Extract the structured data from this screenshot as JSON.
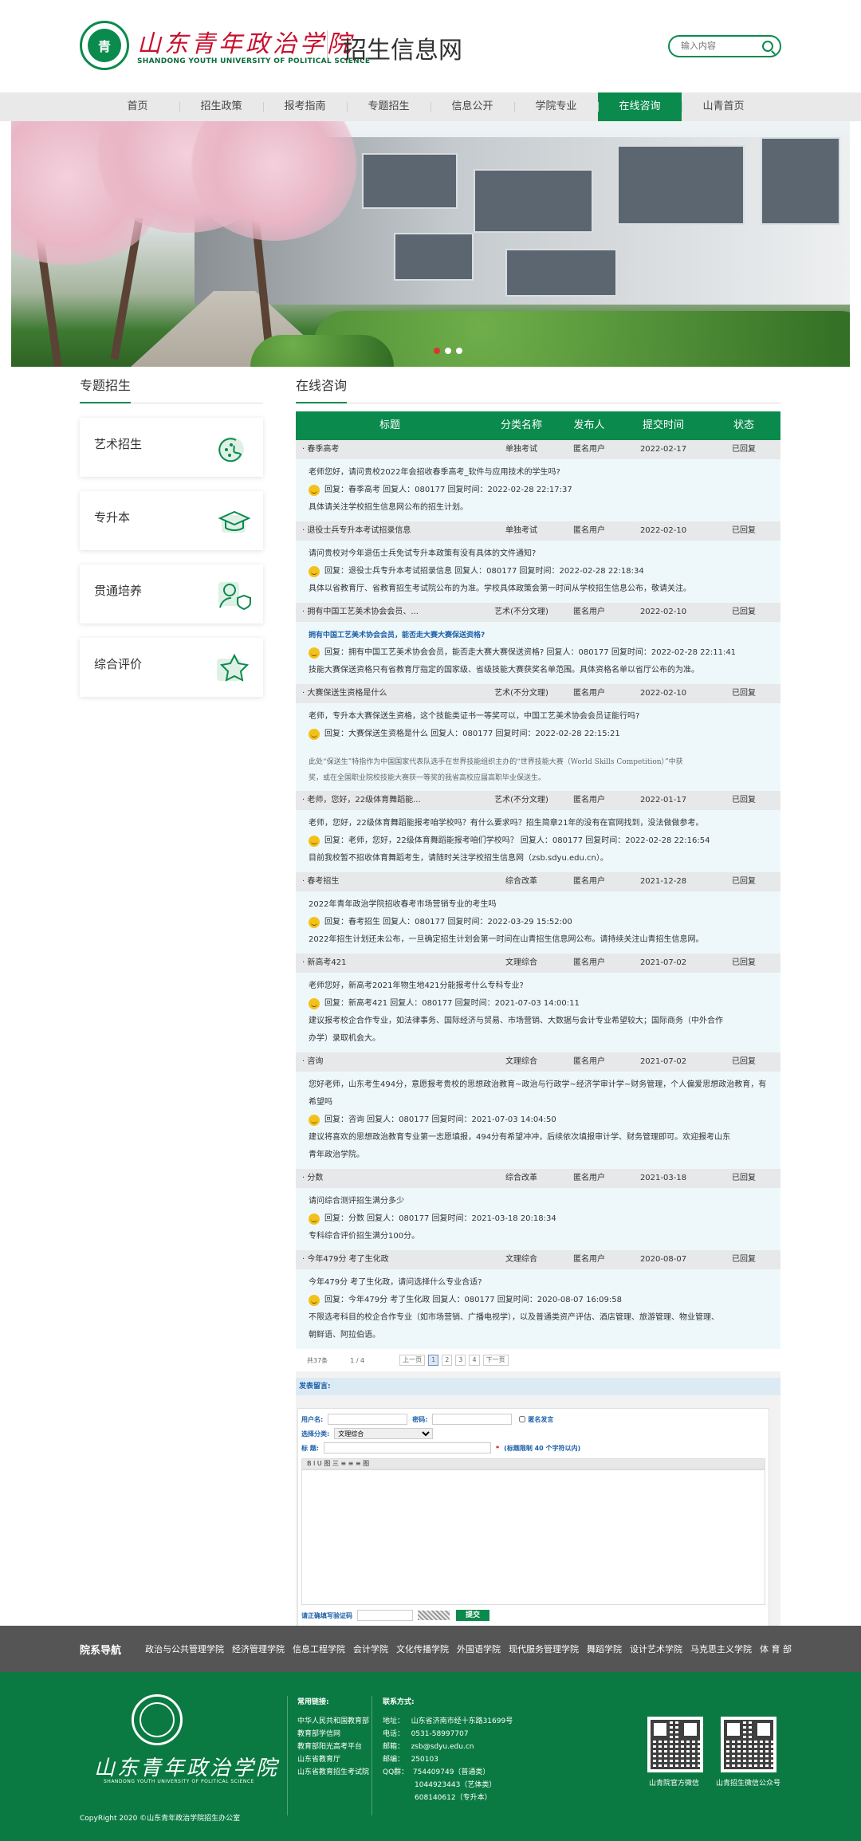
{
  "header": {
    "logo_cn": "山东青年政治学院",
    "logo_en": "SHANDONG YOUTH UNIVERSITY OF POLITICAL SCIENCE",
    "site_title": "招生信息网",
    "search_placeholder": "输入内容"
  },
  "nav": [
    "首页",
    "招生政策",
    "报考指南",
    "专题招生",
    "信息公开",
    "学院专业",
    "在线咨询",
    "山青首页"
  ],
  "nav_active": "在线咨询",
  "sidebar": {
    "title": "专题招生",
    "items": [
      "艺术招生",
      "专升本",
      "贯通培养",
      "综合评价"
    ]
  },
  "main": {
    "title": "在线咨询",
    "columns": [
      "标题",
      "分类名称",
      "发布人",
      "提交时间",
      "状态"
    ],
    "rows": [
      {
        "title": "· 春季高考",
        "cat": "单独考试",
        "user": "匿名用户",
        "date": "2022-02-17",
        "status": "已回复",
        "q": "老师您好，请问贵校2022年会招收春季高考_软件与应用技术的学生吗?",
        "r": "回复：春季高考 回复人：080177 回复时间：2022-02-28 22:17:37",
        "a": [
          "具体请关注学校招生信息网公布的招生计划。"
        ]
      },
      {
        "title": "· 退役士兵专升本考试招录信息",
        "cat": "单独考试",
        "user": "匿名用户",
        "date": "2022-02-10",
        "status": "已回复",
        "q": "请问贵校对今年退伍士兵免试专升本政策有没有具体的文件通知?",
        "r": "回复：退役士兵专升本考试招录信息 回复人：080177 回复时间：2022-02-28 22:18:34",
        "a": [
          "具体以省教育厅、省教育招生考试院公布的为准。学校具体政策会第一时间从学校招生信息公布，敬请关注。"
        ]
      },
      {
        "title": "· 拥有中国工艺美术协会会员、...",
        "cat": "艺术(不分文理)",
        "user": "匿名用户",
        "date": "2022-02-10",
        "status": "已回复",
        "q": "拥有中国工艺美术协会会员，能否走大赛大赛保送资格?",
        "r": "回复：拥有中国工艺美术协会会员，能否走大赛大赛保送资格?  回复人：080177 回复时间：2022-02-28 22:11:41",
        "a": [
          "技能大赛保送资格只有省教育厅指定的国家级、省级技能大赛获奖名单范围。具体资格名单以省厅公布的为准。"
        ]
      },
      {
        "title": "· 大赛保送生资格是什么",
        "cat": "艺术(不分文理)",
        "user": "匿名用户",
        "date": "2022-02-10",
        "status": "已回复",
        "q": "老师，专升本大赛保送生资格，这个技能类证书一等奖可以，中国工艺美术协会会员证能行吗?",
        "r": "回复：大赛保送生资格是什么 回复人：080177 回复时间：2022-02-28 22:15:21",
        "a": [
          "此处“保送生”特指作为中国国家代表队选手在世界技能组织主办的“世界技能大赛（World Skills Competition）”中获",
          "奖，或在全国职业院校技能大赛获一等奖的我省高校应届高职毕业保送生。"
        ]
      },
      {
        "title": "· 老师，您好，22级体育舞蹈能...",
        "cat": "艺术(不分文理)",
        "user": "匿名用户",
        "date": "2022-01-17",
        "status": "已回复",
        "q": "老师，您好，22级体育舞蹈能报考咱学校吗？有什么要求吗？招生简章21年的没有在官网找到，没法做做参考。",
        "r": "回复：老师，您好，22级体育舞蹈能报考咱们学校吗？  回复人：080177 回复时间：2022-02-28 22:16:54",
        "a": [
          "目前我校暂不招收体育舞蹈考生，请随时关注学校招生信息网（zsb.sdyu.edu.cn）。"
        ]
      },
      {
        "title": "· 春考招生",
        "cat": "综合改革",
        "user": "匿名用户",
        "date": "2021-12-28",
        "status": "已回复",
        "q": "2022年青年政治学院招收春考市场营销专业的考生吗",
        "r": "回复：春考招生 回复人：080177 回复时间：2022-03-29 15:52:00",
        "a": [
          "2022年招生计划还未公布，一旦确定招生计划会第一时间在山青招生信息网公布。请持续关注山青招生信息网。"
        ]
      },
      {
        "title": "· 新高考421",
        "cat": "文理综合",
        "user": "匿名用户",
        "date": "2021-07-02",
        "status": "已回复",
        "q": "老师您好，新高考2021年物生地421分能报考什么专科专业?",
        "r": "回复：新高考421 回复人：080177 回复时间：2021-07-03 14:00:11",
        "a": [
          "建议报考校企合作专业，如法律事务、国际经济与贸易、市场营销、大数据与会计专业希望较大；国际商务（中外合作",
          "办学）录取机会大。"
        ]
      },
      {
        "title": "· 咨询",
        "cat": "文理综合",
        "user": "匿名用户",
        "date": "2021-07-02",
        "status": "已回复",
        "q": "您好老师，山东考生494分，意愿报考贵校的思想政治教育~政治与行政学~经济学审计学~财务管理，个人偏爱思想政治教育，有希望吗",
        "r": "回复：咨询 回复人：080177 回复时间：2021-07-03 14:04:50",
        "a": [
          "建议将喜欢的思想政治教育专业第一志愿填报，494分有希望冲冲，后续依次填报审计学、财务管理即可。欢迎报考山东",
          "青年政治学院。"
        ]
      },
      {
        "title": "· 分数",
        "cat": "综合改革",
        "user": "匿名用户",
        "date": "2021-03-18",
        "status": "已回复",
        "q": "请问综合测评招生满分多少",
        "r": "回复：分数 回复人：080177 回复时间：2021-03-18 20:18:34",
        "a": [
          "专科综合评价招生满分100分。"
        ]
      },
      {
        "title": "· 今年479分 考了生化政",
        "cat": "文理综合",
        "user": "匿名用户",
        "date": "2020-08-07",
        "status": "已回复",
        "q": "今年479分 考了生化政，请问选择什么专业合适?",
        "r": "回复：今年479分 考了生化政 回复人：080177 回复时间：2020-08-07 16:09:58",
        "a": [
          "不限选考科目的校企合作专业（如市场营销、广播电视学），以及普通类资产评估、酒店管理、旅游管理、物业管理、",
          "朝鲜语、阿拉伯语。"
        ]
      }
    ],
    "pager": {
      "total": "共37条",
      "page": "1 / 4",
      "first": "上一页",
      "pages": [
        "1",
        "2",
        "3",
        "4"
      ],
      "next": "下一页"
    }
  },
  "form": {
    "title": "发表留言:",
    "username_label": "用户名:",
    "password_label": "密码:",
    "anon_label": "匿名发言",
    "category_label": "选择分类:",
    "category_value": "文理综合",
    "subject_label": "标   题:",
    "subject_hint": "(标题限制 40 个字符以内)",
    "toolbar": "B I U 图 三 ≡ ≡ ≡ 图",
    "captcha_label": "请正确填写验证码",
    "submit": "提交"
  },
  "footer_nav": {
    "title": "院系导航",
    "links": [
      "政治与公共管理学院",
      "经济管理学院",
      "信息工程学院",
      "会计学院",
      "文化传播学院",
      "外国语学院",
      "现代服务管理学院",
      "舞蹈学院",
      "设计艺术学院",
      "马克思主义学院",
      "体 育 部"
    ]
  },
  "footer": {
    "logo_cn": "山东青年政治学院",
    "logo_en": "SHANDONG YOUTH UNIVERSITY OF POLITICAL SCIENCE",
    "copyright": "CopyRight 2020 ©山东青年政治学院招生办公室",
    "links_title": "常用链接:",
    "links": [
      "中华人民共和国教育部",
      "教育部学信网",
      "教育部阳光高考平台",
      "山东省教育厅",
      "山东省教育招生考试院"
    ],
    "contact_title": "联系方式:",
    "contact": [
      "地址：   山东省济南市经十东路31699号",
      "电话：   0531-58997707",
      "邮箱：   zsb@sdyu.edu.cn",
      "邮编：   250103",
      "QQ群：  754409749（普通类）",
      "              1044923443（艺体类）",
      "              608140612（专升本）"
    ],
    "qr1_label": "山青院官方微信",
    "qr2_label": "山青招生微信公众号"
  }
}
